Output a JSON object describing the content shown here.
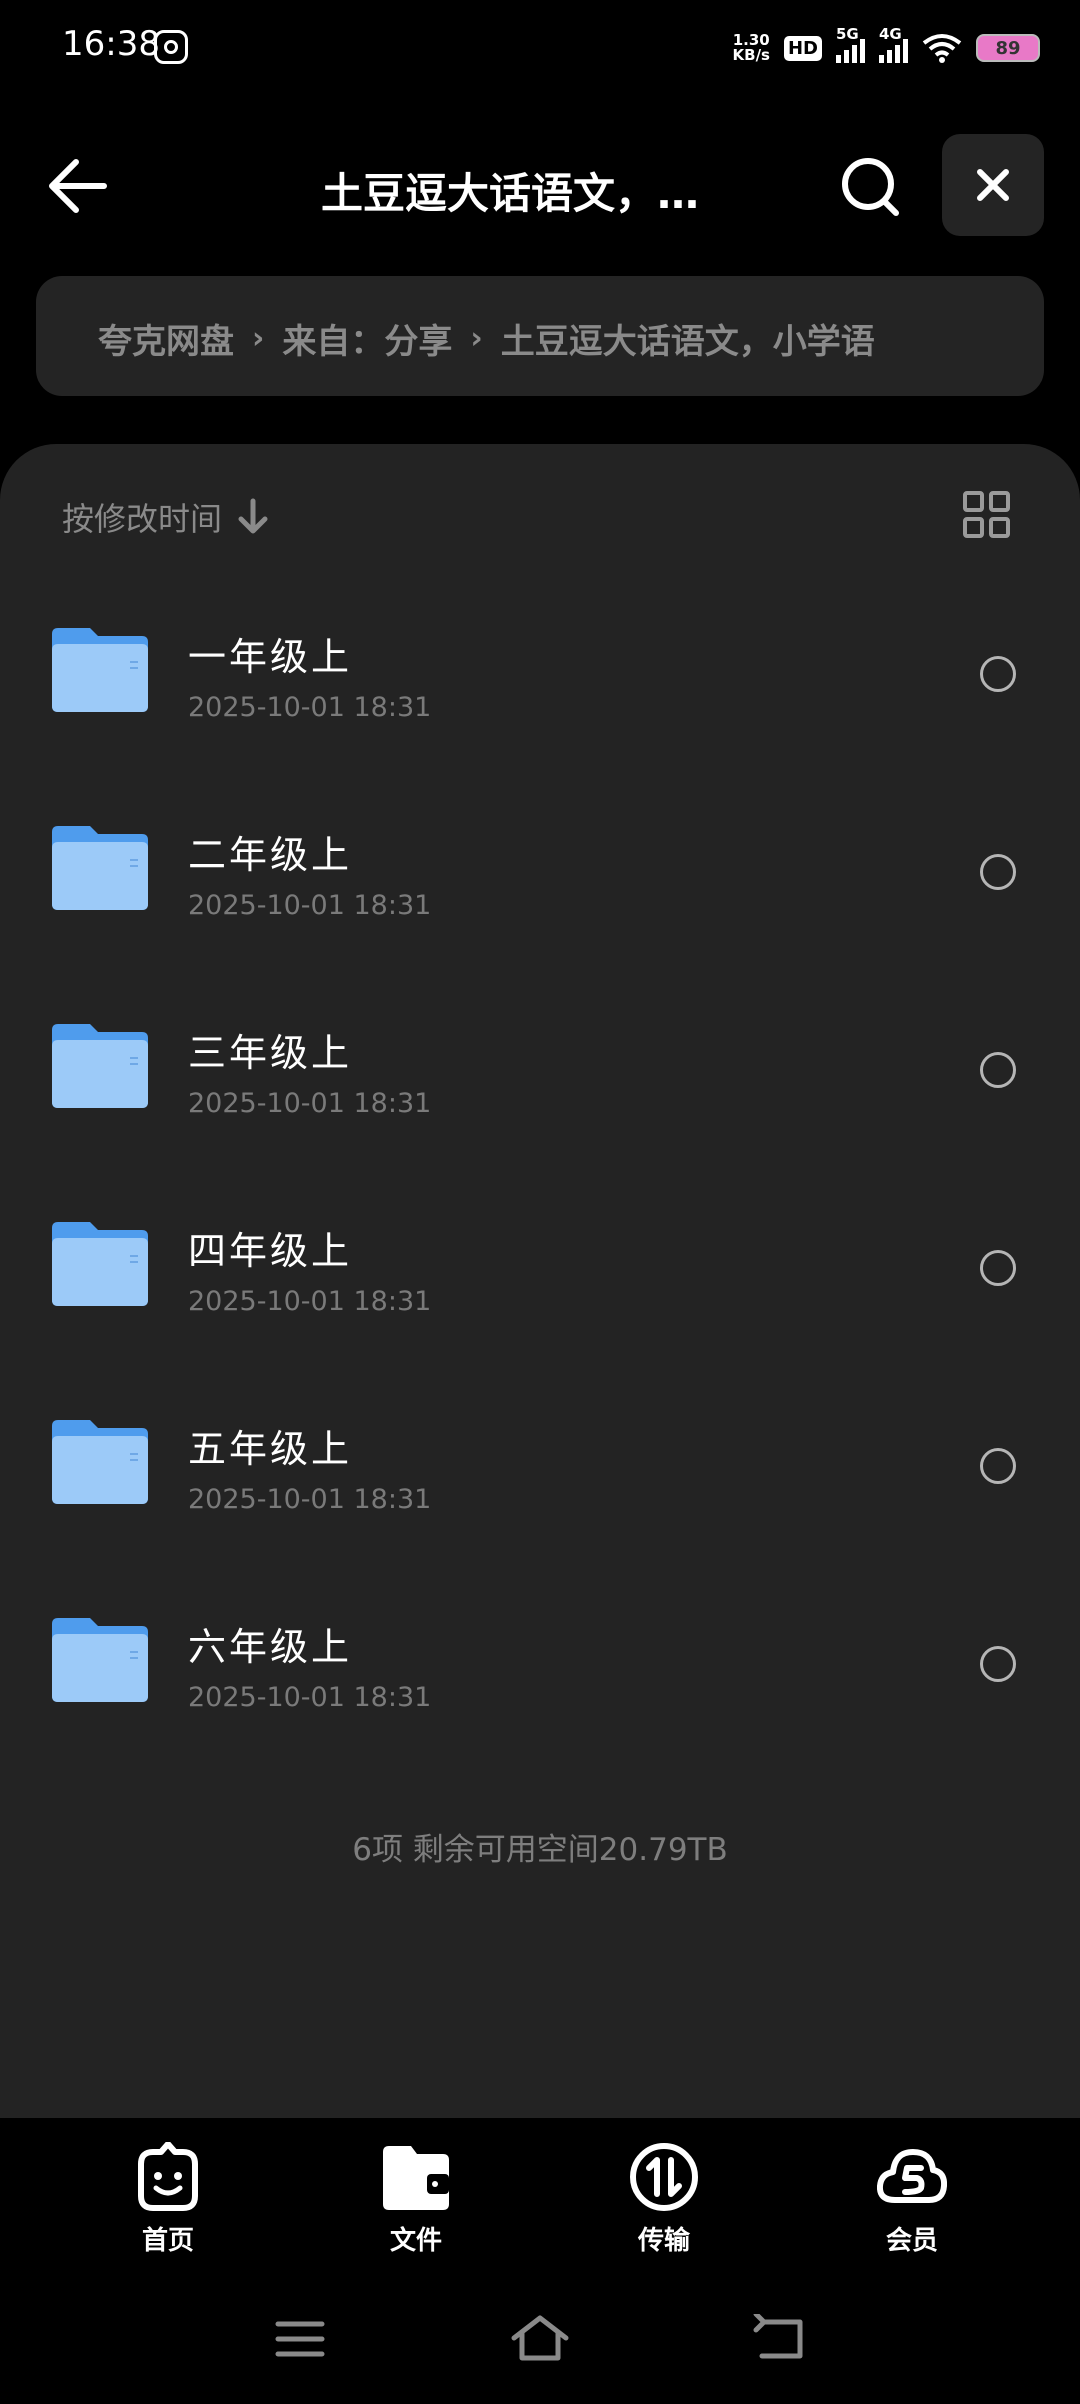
{
  "status": {
    "time": "16:38",
    "speed_value": "1.30",
    "speed_unit": "KB/s",
    "hd": "HD",
    "net1": "5G",
    "net2": "4G",
    "battery": "89"
  },
  "header": {
    "title": "土豆逗大话语文，…"
  },
  "breadcrumb": {
    "items": [
      "夸克网盘",
      "来自：分享",
      "土豆逗大话语文，小学语"
    ]
  },
  "sort": {
    "label": "按修改时间"
  },
  "files": [
    {
      "name": "一年级上",
      "date": "2025-10-01 18:31"
    },
    {
      "name": "二年级上",
      "date": "2025-10-01 18:31"
    },
    {
      "name": "三年级上",
      "date": "2025-10-01 18:31"
    },
    {
      "name": "四年级上",
      "date": "2025-10-01 18:31"
    },
    {
      "name": "五年级上",
      "date": "2025-10-01 18:31"
    },
    {
      "name": "六年级上",
      "date": "2025-10-01 18:31"
    }
  ],
  "summary": "6项 剩余可用空间20.79TB",
  "nav": [
    {
      "label": "首页",
      "icon": "smile-face-icon"
    },
    {
      "label": "文件",
      "icon": "folder-icon"
    },
    {
      "label": "传输",
      "icon": "transfer-icon"
    },
    {
      "label": "会员",
      "icon": "cloud-s-icon"
    }
  ],
  "colors": {
    "background": "#000000",
    "panel": "#232323",
    "folder": "#5aa6f2",
    "muted_text": "#8a8a8a"
  }
}
